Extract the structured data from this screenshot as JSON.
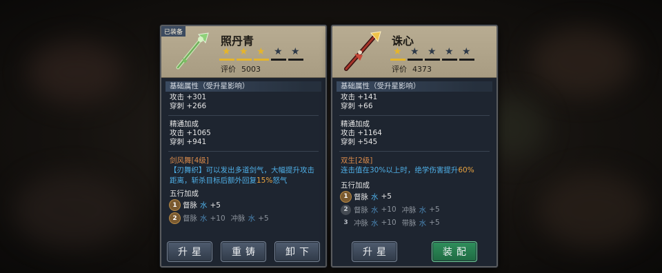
{
  "panels": [
    {
      "equipped_tag": "已装备",
      "name": "照丹青",
      "stars_on": 3,
      "stars_total": 5,
      "rating_label": "评价",
      "rating_value": "5003",
      "base_title": "基础属性（受升星影响）",
      "base_stats": [
        "攻击 +301",
        "穿刺 +266"
      ],
      "mastery_title": "精通加成",
      "mastery_stats": [
        "攻击 +1065",
        "穿刺 +941"
      ],
      "skill_title": "剑风舞[4级]",
      "skill_desc_a": "【刃舞织】可以发出多道剑气，大幅提升攻击距离，斩杀目标后额外回复",
      "skill_desc_hl": "15%",
      "skill_desc_b": "怒气",
      "wuxing_title": "五行加成",
      "wuxing": [
        {
          "n": "1",
          "name": "督脉",
          "el": "水",
          "val": "+5"
        },
        {
          "n": "2",
          "name": "督脉",
          "el": "水",
          "val": "+10",
          "name2": "冲脉",
          "el2": "水",
          "val2": "+5"
        }
      ],
      "buttons": [
        "升星",
        "重铸",
        "卸下"
      ]
    },
    {
      "name": "诛心",
      "stars_on": 1,
      "stars_total": 5,
      "rating_label": "评价",
      "rating_value": "4373",
      "base_title": "基础属性（受升星影响）",
      "base_stats": [
        "攻击 +141",
        "穿刺 +66"
      ],
      "mastery_title": "精通加成",
      "mastery_stats": [
        "攻击 +1164",
        "穿刺 +545"
      ],
      "skill_title": "双生[2级]",
      "skill_desc_a": "连击值在30%以上时，绝学伤害提升",
      "skill_desc_hl": "60%",
      "wuxing_title": "五行加成",
      "wuxing": [
        {
          "n": "1",
          "name": "督脉",
          "el": "水",
          "val": "+5"
        },
        {
          "n": "2",
          "name": "督脉",
          "el": "水",
          "val": "+10",
          "name2": "冲脉",
          "el2": "水",
          "val2": "+5"
        },
        {
          "n": "3",
          "name": "冲脉",
          "el": "水",
          "val": "+10",
          "name2": "带脉",
          "el2": "水",
          "val2": "+5"
        }
      ],
      "buttons": [
        "升星",
        "装配"
      ]
    }
  ],
  "colors": {
    "header_bg": "#b0a48a",
    "panel_bg": "#1e2530",
    "star_on": "#e5b52a",
    "skill_title": "#d98a4a",
    "skill_desc": "#4fb0e8",
    "highlight": "#e9a340",
    "equip_button": "#2f8f5c"
  },
  "icons": {
    "weapon1": "jade-staff-icon",
    "weapon2": "red-spear-icon",
    "star": "star-icon"
  }
}
